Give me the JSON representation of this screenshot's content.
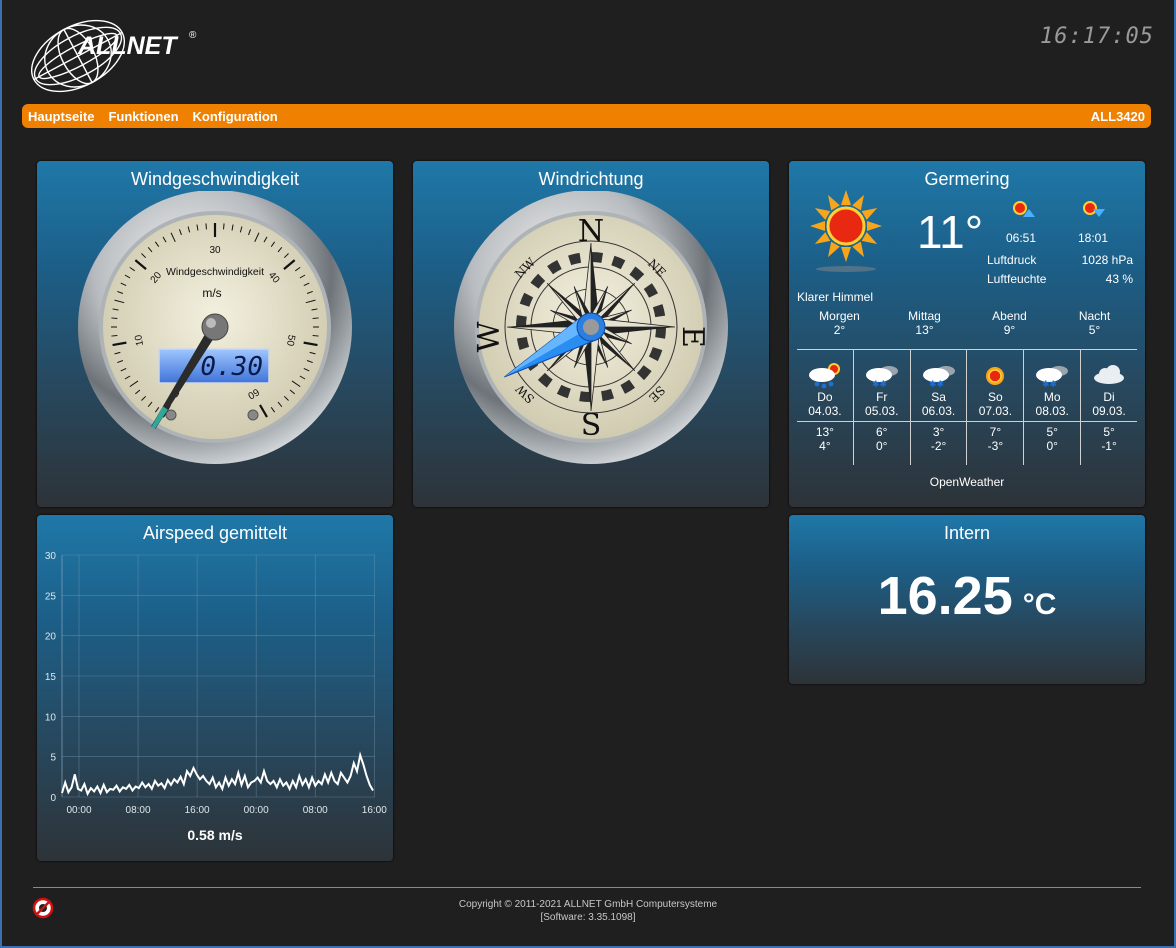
{
  "header": {
    "brand": "ALLNET",
    "brand_mark": "®",
    "clock": "16:17:05"
  },
  "navbar": {
    "items": [
      "Hauptseite",
      "Funktionen",
      "Konfiguration"
    ],
    "device": "ALL3420"
  },
  "wind_speed": {
    "title": "Windgeschwindigkeit",
    "dial_label": "Windgeschwindigkeit",
    "unit": "m/s",
    "ticks": [
      "0",
      "10",
      "20",
      "30",
      "40",
      "50",
      "60"
    ],
    "display": "0.30",
    "value": 0.3,
    "max": 60
  },
  "wind_direction": {
    "title": "Windrichtung",
    "cardinals": [
      "N",
      "E",
      "S",
      "W"
    ],
    "intercardinals": [
      "NE",
      "SE",
      "SW",
      "NW"
    ],
    "degrees": 240
  },
  "weather": {
    "title": "Germering",
    "temp": "11°",
    "condition": "Klarer Himmel",
    "sunrise": "06:51",
    "sunset": "18:01",
    "pressure_label": "Luftdruck",
    "pressure": "1028 hPa",
    "humidity_label": "Luftfeuchte",
    "humidity": "43 %",
    "dayparts": [
      {
        "label": "Morgen",
        "temp": "2°"
      },
      {
        "label": "Mittag",
        "temp": "13°"
      },
      {
        "label": "Abend",
        "temp": "9°"
      },
      {
        "label": "Nacht",
        "temp": "5°"
      }
    ],
    "forecast": [
      {
        "day": "Do",
        "date": "04.03.",
        "high": "13°",
        "low": "4°",
        "icon": "rain-sun-icon"
      },
      {
        "day": "Fr",
        "date": "05.03.",
        "high": "6°",
        "low": "0°",
        "icon": "snow-cloud-icon"
      },
      {
        "day": "Sa",
        "date": "06.03.",
        "high": "3°",
        "low": "-2°",
        "icon": "snow-cloud-icon"
      },
      {
        "day": "So",
        "date": "07.03.",
        "high": "7°",
        "low": "-3°",
        "icon": "sun-icon"
      },
      {
        "day": "Mo",
        "date": "08.03.",
        "high": "5°",
        "low": "0°",
        "icon": "snow-cloud-icon"
      },
      {
        "day": "Di",
        "date": "09.03.",
        "high": "5°",
        "low": "-1°",
        "icon": "cloud-icon"
      }
    ],
    "source": "OpenWeather"
  },
  "airspeed": {
    "title": "Airspeed gemittelt",
    "current": "0.58 m/s"
  },
  "chart_data": {
    "type": "line",
    "title": "Airspeed gemittelt",
    "xlabel": "",
    "ylabel": "",
    "ylim": [
      0,
      30
    ],
    "yticks": [
      "30",
      "25",
      "20",
      "15",
      "10",
      "5",
      "0"
    ],
    "xticks": [
      "00:00",
      "08:00",
      "16:00",
      "00:00",
      "08:00",
      "16:00"
    ],
    "grid": true,
    "series": [
      {
        "values": [
          0.5,
          1.8,
          0.6,
          1.2,
          2.8,
          1.0,
          0.8,
          1.6,
          0.4,
          1.1,
          0.7,
          1.3,
          0.5,
          1.5,
          0.6,
          1.0,
          0.9,
          1.4,
          0.7,
          1.2,
          1.0,
          1.5,
          0.8,
          1.3,
          1.1,
          1.8,
          1.2,
          1.6,
          1.0,
          2.0,
          1.4,
          1.7,
          1.1,
          2.1,
          1.5,
          2.2,
          1.8,
          2.5,
          1.6,
          3.2,
          2.6,
          3.6,
          2.8,
          2.2,
          2.6,
          2.0,
          1.6,
          2.4,
          1.2,
          1.8,
          1.0,
          2.4,
          1.4,
          2.2,
          1.6,
          3.0,
          1.5,
          2.6,
          1.2,
          1.8,
          2.0,
          2.4,
          1.8,
          3.2,
          2.0,
          1.6,
          2.0,
          1.2,
          2.2,
          1.4,
          1.8,
          1.0,
          2.0,
          1.2,
          2.6,
          1.5,
          2.2,
          1.2,
          2.4,
          1.4,
          2.0,
          1.6,
          2.8,
          1.8,
          3.0,
          2.0,
          1.6,
          3.0,
          2.4,
          1.8,
          2.6,
          4.2,
          3.2,
          5.2,
          4.0,
          2.6,
          1.5,
          0.8
        ]
      }
    ]
  },
  "intern": {
    "title": "Intern",
    "value": "16.25",
    "unit": "°C"
  },
  "footer": {
    "copyright": "Copyright © 2011-2021 ALLNET GmbH Computersysteme",
    "software": "[Software: 3.35.1098]"
  }
}
